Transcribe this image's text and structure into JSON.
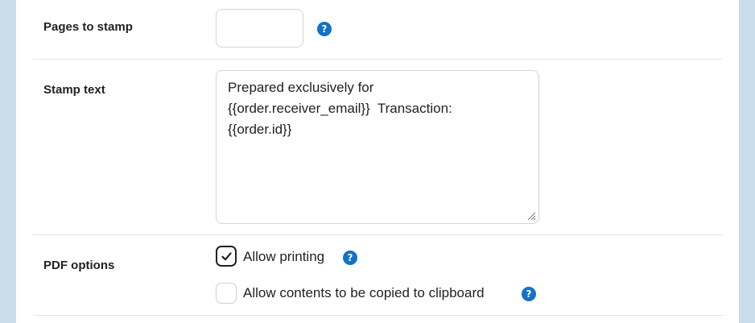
{
  "fields": {
    "pages_to_stamp": {
      "label": "Pages to stamp",
      "value": "",
      "help_icon": "?"
    },
    "stamp_text": {
      "label": "Stamp text",
      "value": "Prepared exclusively for\n{{order.receiver_email}}  Transaction:\n{{order.id}}"
    },
    "pdf_options": {
      "label": "PDF options",
      "options": [
        {
          "label": "Allow printing",
          "checked": true,
          "help_icon": "?"
        },
        {
          "label": "Allow contents to be copied to clipboard",
          "checked": false,
          "help_icon": "?"
        }
      ]
    }
  },
  "colors": {
    "help_icon": "#1173c6",
    "background": "#c9dcea"
  },
  "icons": {
    "help": "question-circle-icon",
    "check": "checkmark-icon",
    "resize": "resize-grip-icon"
  }
}
